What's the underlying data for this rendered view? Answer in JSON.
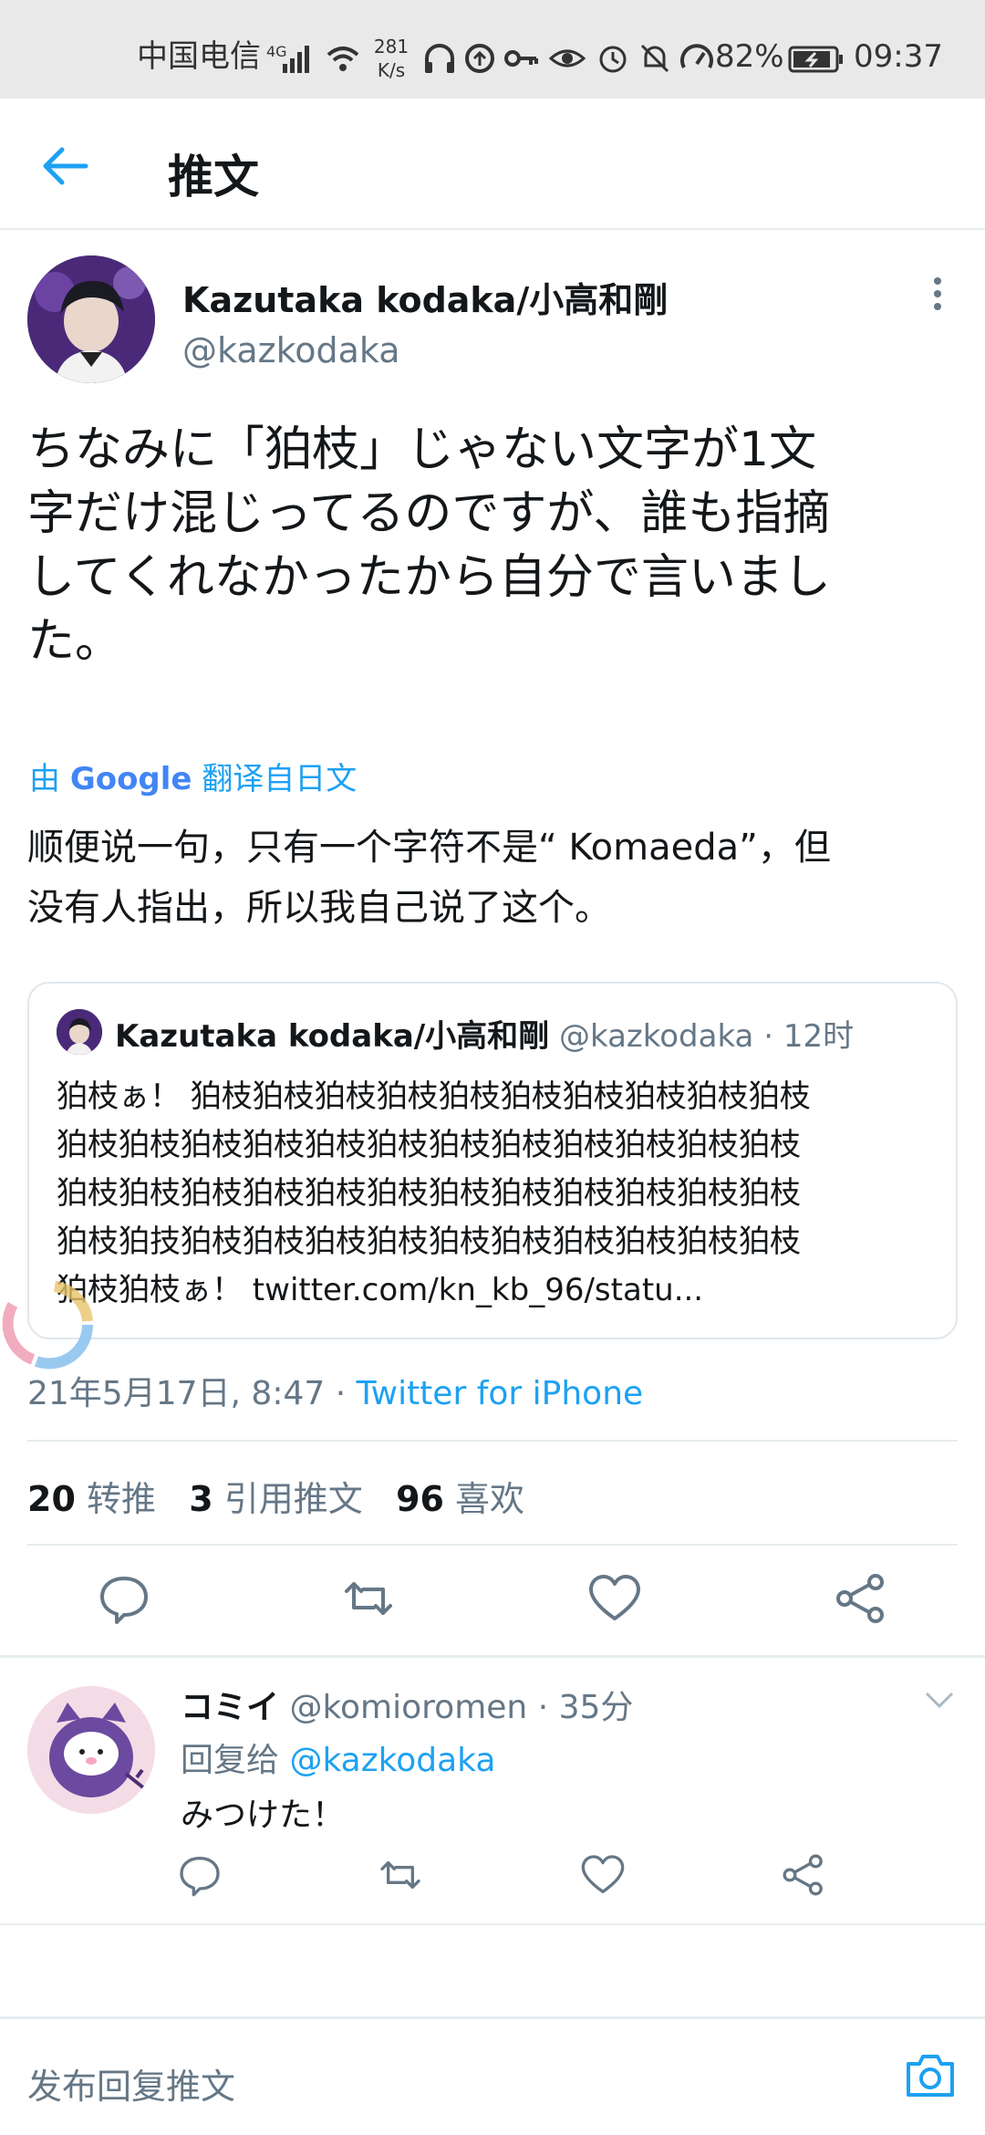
{
  "status_bar": {
    "carrier": "中国电信",
    "network": "4G",
    "speed_value": "281",
    "speed_unit": "K/s",
    "battery": "82%",
    "time": "09:37"
  },
  "header": {
    "title": "推文"
  },
  "tweet": {
    "author_name": "Kazutaka kodaka/小高和剛",
    "author_handle": "@kazkodaka",
    "body_lines": [
      "ちなみに「狛枝」じゃない文字が1文",
      "字だけ混じってるのですが、誰も指摘",
      "してくれなかったから自分で言いまし",
      "た。"
    ],
    "translate_prefix": "由",
    "translate_google": "Google",
    "translate_suffix": "翻译自日文",
    "translation_lines": [
      "顺便说一句，只有一个字符不是“ Komaeda”，但",
      "没有人指出，所以我自己说了这个。"
    ],
    "quote": {
      "author_name": "Kazutaka kodaka/小高和剛",
      "author_handle": "@kazkodaka",
      "time": "· 12时",
      "lines": [
        "狛枝ぁ！ 狛枝狛枝狛枝狛枝狛枝狛枝狛枝狛枝狛枝狛枝",
        "狛枝狛枝狛枝狛枝狛枝狛枝狛枝狛枝狛枝狛枝狛枝狛枝",
        "狛枝狛枝狛枝狛枝狛枝狛枝狛枝狛枝狛枝狛枝狛枝狛枝",
        "狛枝狛技狛枝狛枝狛枝狛枝狛枝狛枝狛枝狛枝狛枝狛枝",
        "狛枝狛枝ぁ！ twitter.com/kn_kb_96/statu..."
      ]
    },
    "timestamp": "21年5月17日, 8:47 ·",
    "source": "Twitter for iPhone",
    "stats": {
      "retweets_count": "20",
      "retweets_label": "转推",
      "quotes_count": "3",
      "quotes_label": "引用推文",
      "likes_count": "96",
      "likes_label": "喜欢"
    }
  },
  "reply": {
    "author_name": "コミイ",
    "author_handle": "@komioromen",
    "time": "· 35分",
    "reply_to_label": "回复给",
    "reply_to_handle": "@kazkodaka",
    "text": "みつけた！"
  },
  "composer": {
    "placeholder": "发布回复推文"
  },
  "colors": {
    "accent": "#1da1f2",
    "muted": "#657786",
    "divider": "#e6ecf0"
  }
}
